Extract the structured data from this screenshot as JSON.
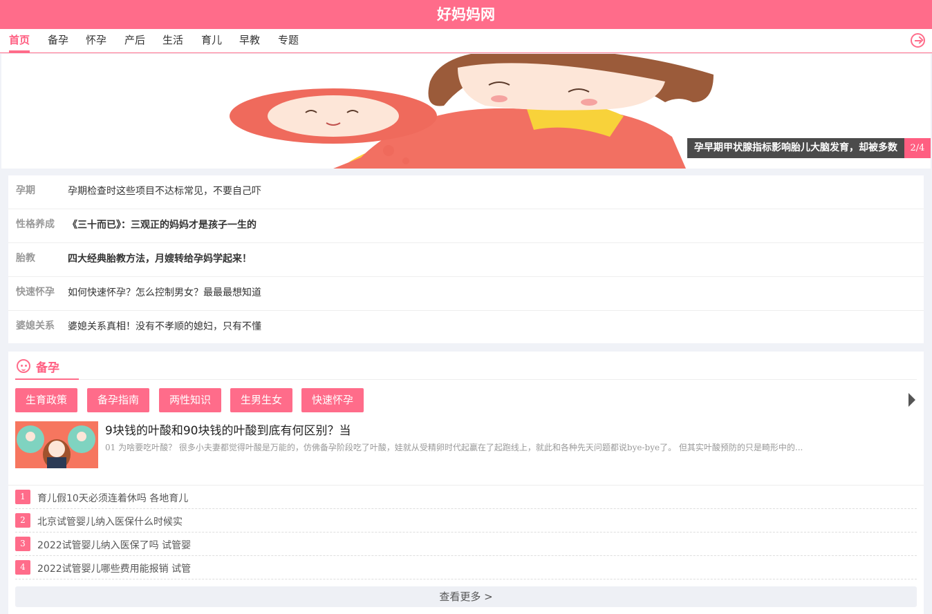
{
  "site_title": "好妈妈网",
  "nav": {
    "items": [
      "首页",
      "备孕",
      "怀孕",
      "产后",
      "生活",
      "育儿",
      "早教",
      "专题"
    ],
    "active_index": 0
  },
  "banner": {
    "caption": "孕早期甲状腺指标影响胎儿大脑发育，却被多数",
    "counter": "2/4"
  },
  "hotlist": [
    {
      "category": "孕期",
      "title": "孕期检查时这些项目不达标常见，不要自己吓",
      "bold": false
    },
    {
      "category": "性格养成",
      "title": "《三十而已》：三观正的妈妈才是孩子一生的",
      "bold": true
    },
    {
      "category": "胎教",
      "title": "四大经典胎教方法，月嫂转给孕妈学起来！",
      "bold": true
    },
    {
      "category": "快速怀孕",
      "title": "如何快速怀孕？怎么控制男女？最最最想知道",
      "bold": false
    },
    {
      "category": "婆媳关系",
      "title": "婆媳关系真相！没有不孝顺的媳妇，只有不懂",
      "bold": false
    }
  ],
  "section": {
    "title": "备孕",
    "tags": [
      "生育政策",
      "备孕指南",
      "两性知识",
      "生男生女",
      "快速怀孕"
    ],
    "feature": {
      "title": "9块钱的叶酸和90块钱的叶酸到底有何区别？当",
      "desc": "01 为啥要吃叶酸？ 很多小夫妻都觉得叶酸是万能的，仿佛备孕阶段吃了叶酸，娃就从受精卵时代起赢在了起跑线上，就此和各种先天问题都说bye-bye了。 但其实叶酸预防的只是畸形中的..."
    },
    "ranked": [
      {
        "num": "1",
        "title": "育儿假10天必须连着休吗 各地育儿"
      },
      {
        "num": "2",
        "title": "北京试管婴儿纳入医保什么时候实"
      },
      {
        "num": "3",
        "title": "2022试管婴儿纳入医保了吗 试管婴"
      },
      {
        "num": "4",
        "title": "2022试管婴儿哪些费用能报销 试管"
      }
    ],
    "more_label": "查看更多 >"
  },
  "colors": {
    "accent": "#ff6c8a",
    "background": "#f0f2f7"
  }
}
